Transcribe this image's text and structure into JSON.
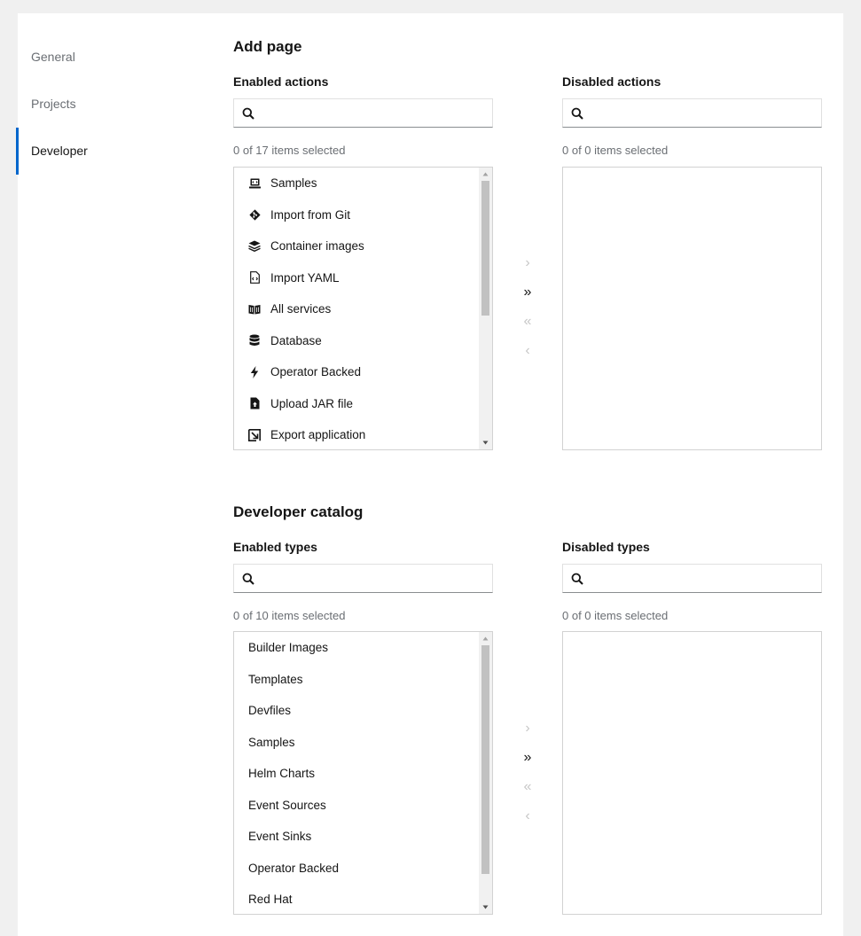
{
  "tabs": [
    {
      "label": "General",
      "active": false
    },
    {
      "label": "Projects",
      "active": false
    },
    {
      "label": "Developer",
      "active": true
    }
  ],
  "add_page": {
    "title": "Add page",
    "enabled": {
      "label": "Enabled actions",
      "search_placeholder": "",
      "count": "0 of 17 items selected",
      "items": [
        {
          "label": "Samples",
          "icon": "laptop-code-icon"
        },
        {
          "label": "Import from Git",
          "icon": "git-icon"
        },
        {
          "label": "Container images",
          "icon": "layer-group-icon"
        },
        {
          "label": "Import YAML",
          "icon": "file-code-icon"
        },
        {
          "label": "All services",
          "icon": "book-icon"
        },
        {
          "label": "Database",
          "icon": "database-icon"
        },
        {
          "label": "Operator Backed",
          "icon": "bolt-icon"
        },
        {
          "label": "Upload JAR file",
          "icon": "file-upload-icon"
        },
        {
          "label": "Export application",
          "icon": "export-icon"
        }
      ]
    },
    "disabled": {
      "label": "Disabled actions",
      "search_placeholder": "",
      "count": "0 of 0 items selected"
    }
  },
  "catalog": {
    "title": "Developer catalog",
    "enabled": {
      "label": "Enabled types",
      "search_placeholder": "",
      "count": "0 of 10 items selected",
      "items": [
        "Builder Images",
        "Templates",
        "Devfiles",
        "Samples",
        "Helm Charts",
        "Event Sources",
        "Event Sinks",
        "Operator Backed",
        "Red Hat"
      ]
    },
    "disabled": {
      "label": "Disabled types",
      "search_placeholder": "",
      "count": "0 of 0 items selected"
    }
  },
  "controls": {
    "add_selected": "›",
    "add_all": "»",
    "remove_all": "«",
    "remove_selected": "‹"
  },
  "colors": {
    "accent": "#0066cc",
    "muted": "#6a6e73",
    "disabled": "#c7c7c7"
  }
}
